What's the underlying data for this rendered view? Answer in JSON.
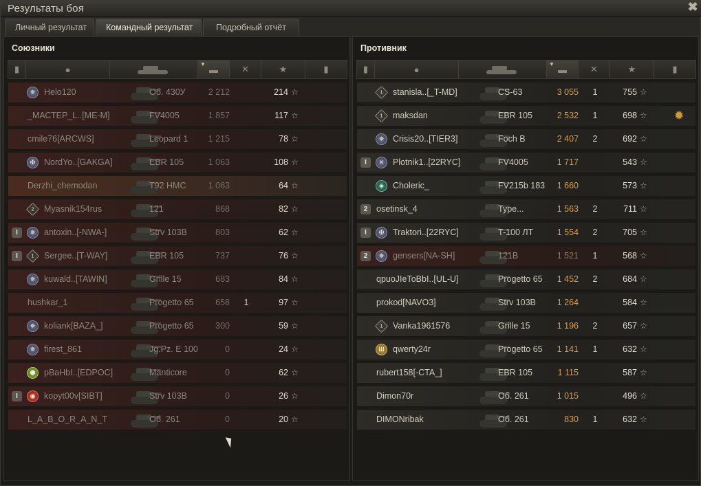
{
  "window": {
    "title": "Результаты боя",
    "close_glyph": "✖"
  },
  "tabs": [
    {
      "label": "Личный результат"
    },
    {
      "label": "Командный результат"
    },
    {
      "label": "Подробный отчёт"
    }
  ],
  "allies": {
    "title": "Союзники",
    "rows": [
      {
        "badge": "✵",
        "name": "Helo120",
        "vehicle": "Об. 430У",
        "damage": "2 212",
        "kills": "",
        "xp": "214",
        "row_tint": "red",
        "dead": true
      },
      {
        "badge": "",
        "name": "_МАСТЕР_L..[ME-M]",
        "vehicle": "FV4005",
        "damage": "1 857",
        "kills": "",
        "xp": "117",
        "row_tint": "red",
        "dead": true
      },
      {
        "badge": "",
        "name": "cmile76[ARCWS]",
        "vehicle": "Leopard 1",
        "damage": "1 215",
        "kills": "",
        "xp": "78",
        "row_tint": "red",
        "dead": true
      },
      {
        "badge": "✠",
        "name": "NordYo..[GAKGA]",
        "vehicle": "EBR 105",
        "damage": "1 063",
        "kills": "",
        "xp": "108",
        "row_tint": "red",
        "dead": true
      },
      {
        "badge": "",
        "name": "Derzhi_chemodan",
        "vehicle": "T92 HMC",
        "damage": "1 063",
        "kills": "",
        "xp": "64",
        "row_tint": "orange",
        "dead": true
      },
      {
        "badge": "2",
        "name": "Myasnik154rus",
        "vehicle": "121",
        "damage": "868",
        "kills": "",
        "xp": "82",
        "row_tint": "red",
        "dead": true
      },
      {
        "platoon": "I",
        "badge": "✵",
        "name": "antoxin..[-NWA-]",
        "vehicle": "Strv 103B",
        "damage": "803",
        "kills": "",
        "xp": "62",
        "row_tint": "red",
        "dead": true
      },
      {
        "platoon": "I",
        "badge": "1",
        "name": "Sergee..[T-WAY]",
        "vehicle": "EBR 105",
        "damage": "737",
        "kills": "",
        "xp": "76",
        "row_tint": "red",
        "dead": true
      },
      {
        "badge": "✵",
        "name": "kuwald..[TAWIN]",
        "vehicle": "Grille 15",
        "damage": "683",
        "kills": "",
        "xp": "84",
        "row_tint": "red",
        "dead": true
      },
      {
        "badge": "",
        "name": "hushkar_1",
        "vehicle": "Progetto 65",
        "damage": "658",
        "kills": "1",
        "xp": "97",
        "row_tint": "red",
        "dead": true
      },
      {
        "badge": "✵",
        "name": "koliank[BAZA_]",
        "vehicle": "Progetto 65",
        "damage": "300",
        "kills": "",
        "xp": "59",
        "row_tint": "red",
        "dead": true
      },
      {
        "badge": "✵",
        "name": "firest_861",
        "vehicle": "Jg.Pz. E 100",
        "damage": "0",
        "kills": "",
        "xp": "24",
        "row_tint": "red",
        "dead": true
      },
      {
        "badge": "⬢",
        "name": "pBaHbI..[EDPOC]",
        "vehicle": "Manticore",
        "damage": "0",
        "kills": "",
        "xp": "62",
        "row_tint": "red",
        "dead": true
      },
      {
        "platoon": "I",
        "badge": "◉",
        "name": "kopyt00v[SIBT]",
        "vehicle": "Strv 103B",
        "damage": "0",
        "kills": "",
        "xp": "26",
        "row_tint": "red",
        "dead": true
      },
      {
        "badge": "",
        "name": "L_A_B_O_R_A_N_T",
        "vehicle": "Об. 261",
        "damage": "0",
        "kills": "",
        "xp": "20",
        "row_tint": "red",
        "dead": true
      }
    ]
  },
  "enemies": {
    "title": "Противник",
    "rows": [
      {
        "badge": "1",
        "name": "stanisla..[_T-MD]",
        "vehicle": "CS-63",
        "damage": "3 055",
        "kills": "1",
        "xp": "755",
        "row_tint": "",
        "dead": false
      },
      {
        "badge": "1",
        "name": "maksdan",
        "vehicle": "EBR 105",
        "damage": "2 532",
        "kills": "1",
        "xp": "698",
        "row_tint": "",
        "dead": false,
        "medal": "✹"
      },
      {
        "badge": "✵",
        "name": "Crisis20..[TIER3]",
        "vehicle": "Foch B",
        "damage": "2 407",
        "kills": "2",
        "xp": "692",
        "row_tint": "",
        "dead": false
      },
      {
        "platoon": "I",
        "badge": "✕",
        "name": "Plotnik1..[22RYC]",
        "vehicle": "FV4005",
        "damage": "1 717",
        "kills": "",
        "xp": "543",
        "row_tint": "",
        "dead": false
      },
      {
        "badge": "◈",
        "name": "Choleric_",
        "vehicle": "FV215b 183",
        "damage": "1 660",
        "kills": "",
        "xp": "573",
        "row_tint": "",
        "dead": false
      },
      {
        "platoon": "2",
        "badge": "",
        "name": "osetinsk_4",
        "vehicle": "Type...",
        "damage": "1 563",
        "kills": "2",
        "xp": "711",
        "row_tint": "",
        "dead": false
      },
      {
        "platoon": "I",
        "badge": "✠",
        "name": "Traktori..[22RYC]",
        "vehicle": "T-100 ЛТ",
        "damage": "1 554",
        "kills": "2",
        "xp": "705",
        "row_tint": "",
        "dead": false
      },
      {
        "platoon": "2",
        "badge": "✵",
        "name": "gensers[NA-SH]",
        "vehicle": "121B",
        "damage": "1 521",
        "kills": "1",
        "xp": "568",
        "row_tint": "red",
        "dead": true
      },
      {
        "badge": "",
        "name": "qpuoJIeToBbI..[UL-U]",
        "vehicle": "Progetto 65",
        "damage": "1 452",
        "kills": "2",
        "xp": "684",
        "row_tint": "",
        "dead": false
      },
      {
        "badge": "",
        "name": "prokod[NAVO3]",
        "vehicle": "Strv 103B",
        "damage": "1 264",
        "kills": "",
        "xp": "584",
        "row_tint": "",
        "dead": false
      },
      {
        "badge": "1",
        "name": "Vanka1961576",
        "vehicle": "Grille 15",
        "damage": "1 196",
        "kills": "2",
        "xp": "657",
        "row_tint": "",
        "dead": false
      },
      {
        "badge": "Ш",
        "name": "qwerty24r",
        "vehicle": "Progetto 65",
        "damage": "1 141",
        "kills": "1",
        "xp": "632",
        "row_tint": "",
        "dead": false
      },
      {
        "badge": "",
        "name": "rubert158[-CTA_]",
        "vehicle": "EBR 105",
        "damage": "1 115",
        "kills": "",
        "xp": "587",
        "row_tint": "",
        "dead": false
      },
      {
        "badge": "",
        "name": "Dimon70r",
        "vehicle": "Об. 261",
        "damage": "1 015",
        "kills": "",
        "xp": "496",
        "row_tint": "",
        "dead": false
      },
      {
        "badge": "",
        "name": "DIMONribak",
        "vehicle": "Об. 261",
        "damage": "830",
        "kills": "1",
        "xp": "632",
        "row_tint": "",
        "dead": false
      }
    ]
  },
  "header_icons": [
    "platoon-icon",
    "player-icon",
    "vehicle-icon",
    "damage-icon",
    "kills-icon",
    "xp-star-icon",
    "medal-icon"
  ],
  "star_glyph": "☆",
  "colors": {
    "enemy_damage": "#e29a3c",
    "sort_arrow": "#d8c488",
    "row_red_tint": "#3a211e",
    "row_orange_tint": "#4a2c1f"
  }
}
